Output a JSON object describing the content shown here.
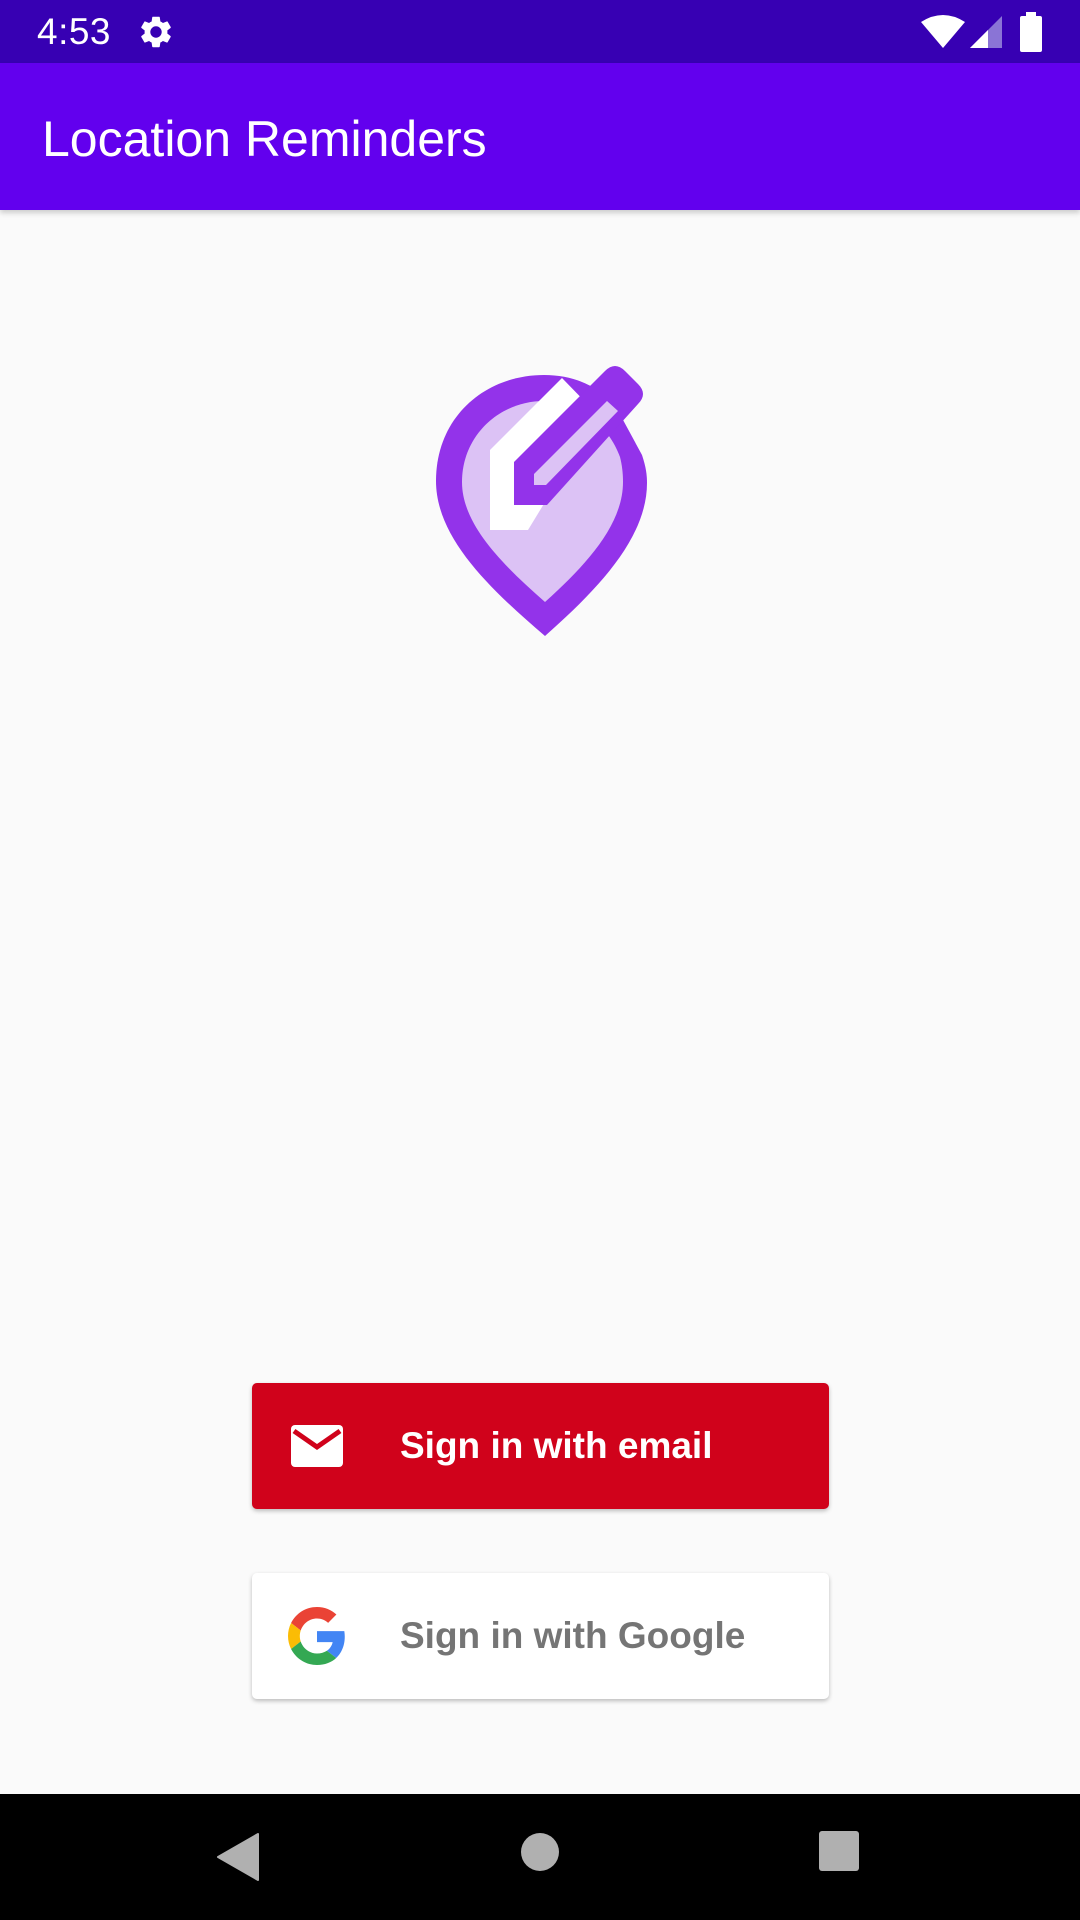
{
  "status_bar": {
    "time": "4:53",
    "icons": [
      "gear-icon",
      "wifi-icon",
      "signal-icon",
      "battery-icon"
    ],
    "background_color": "#3700b3"
  },
  "app_bar": {
    "title": "Location Reminders",
    "background_color": "#6200ee"
  },
  "logo": {
    "icon": "location-pin-pencil-icon",
    "primary_color": "#9333ea",
    "fill_color": "#dcc2f5"
  },
  "auth_buttons": {
    "email": {
      "label": "Sign in with email",
      "icon": "mail-icon",
      "background_color": "#d0021b",
      "text_color": "#ffffff"
    },
    "google": {
      "label": "Sign in with Google",
      "icon": "google-g-icon",
      "background_color": "#ffffff",
      "text_color": "#757575"
    }
  },
  "nav_bar": {
    "icons": [
      "back-icon",
      "home-icon",
      "recent-apps-icon"
    ]
  }
}
